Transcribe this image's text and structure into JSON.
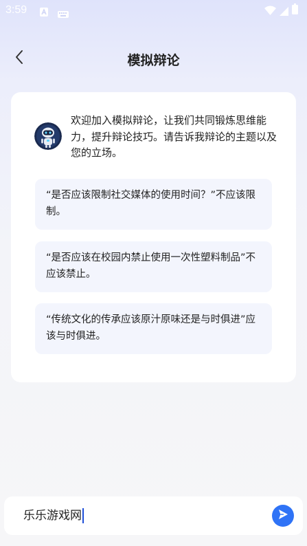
{
  "status_bar": {
    "time": "3:59"
  },
  "header": {
    "title": "模拟辩论",
    "back_icon": "chevron-left-icon"
  },
  "chat": {
    "assistant_avatar": "robot-avatar",
    "welcome_message": "欢迎加入模拟辩论，让我们共同锻炼思维能力，提升辩论技巧。请告诉我辩论的主题以及您的立场。",
    "suggestions": [
      "“是否应该限制社交媒体的使用时间？”不应该限制。",
      "“是否应该在校园内禁止使用一次性塑料制品”不应该禁止。",
      "“传统文化的传承应该原汁原味还是与时俱进”应该与时俱进。"
    ]
  },
  "composer": {
    "value": "乐乐游戏网",
    "send_icon": "send-icon",
    "accent": "#2f73f6"
  }
}
